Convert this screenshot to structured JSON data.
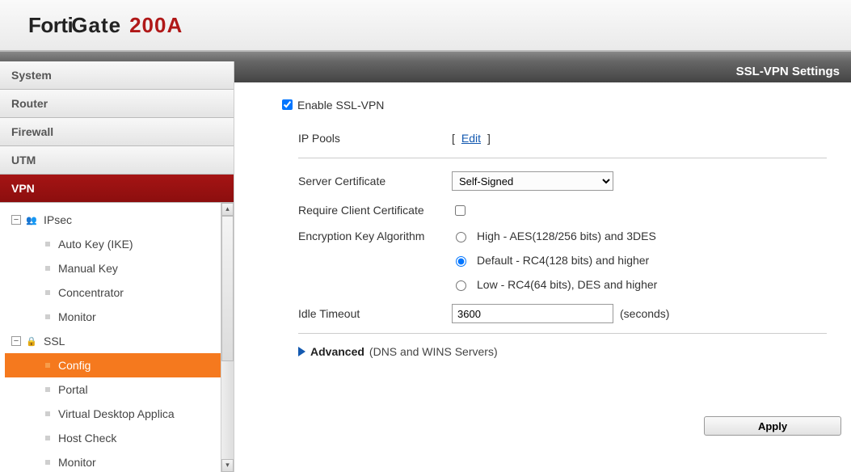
{
  "brand": {
    "part1": "Forti",
    "part2": "Gate",
    "model": "200A"
  },
  "nav": [
    {
      "label": "System",
      "active": false
    },
    {
      "label": "Router",
      "active": false
    },
    {
      "label": "Firewall",
      "active": false
    },
    {
      "label": "UTM",
      "active": false
    },
    {
      "label": "VPN",
      "active": true
    }
  ],
  "tree": {
    "ipsec": {
      "label": "IPsec",
      "children": [
        {
          "label": "Auto Key (IKE)"
        },
        {
          "label": "Manual Key"
        },
        {
          "label": "Concentrator"
        },
        {
          "label": "Monitor"
        }
      ]
    },
    "ssl": {
      "label": "SSL",
      "children": [
        {
          "label": "Config",
          "selected": true
        },
        {
          "label": "Portal"
        },
        {
          "label": "Virtual Desktop Applica"
        },
        {
          "label": "Host Check"
        },
        {
          "label": "Monitor"
        }
      ]
    }
  },
  "page": {
    "title": "SSL-VPN Settings",
    "enable_label": "Enable SSL-VPN",
    "enable_checked": true,
    "ip_pools_label": "IP Pools",
    "edit_link": "Edit",
    "server_cert_label": "Server Certificate",
    "server_cert_value": "Self-Signed",
    "require_client_cert_label": "Require Client Certificate",
    "require_client_cert_checked": false,
    "enc_algo_label": "Encryption Key Algorithm",
    "enc_options": [
      {
        "label": "High - AES(128/256 bits) and 3DES",
        "value": "high"
      },
      {
        "label": "Default - RC4(128 bits) and higher",
        "value": "default"
      },
      {
        "label": "Low - RC4(64 bits), DES and higher",
        "value": "low"
      }
    ],
    "enc_selected": "default",
    "idle_timeout_label": "Idle Timeout",
    "idle_timeout_value": "3600",
    "idle_timeout_unit": "(seconds)",
    "advanced_label": "Advanced",
    "advanced_suffix": "(DNS and WINS Servers)",
    "apply_label": "Apply"
  }
}
